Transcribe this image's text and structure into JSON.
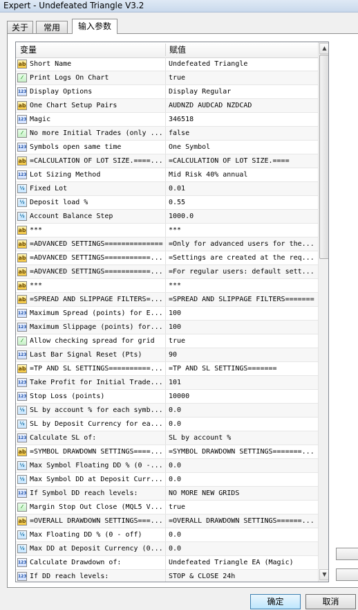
{
  "window": {
    "title": "Expert - Undefeated Triangle V3.2"
  },
  "tabs": [
    {
      "label": "关于"
    },
    {
      "label": "常用"
    },
    {
      "label": "输入参数"
    }
  ],
  "grid": {
    "columns": {
      "variable": "变量",
      "value": "赋值"
    },
    "rows": [
      {
        "icon": "string-icon",
        "name": "Short Name",
        "value": "Undefeated Triangle"
      },
      {
        "icon": "bool-icon",
        "name": "Print Logs On Chart",
        "value": "true"
      },
      {
        "icon": "int-icon",
        "name": "Display Options",
        "value": "Display Regular"
      },
      {
        "icon": "string-icon",
        "name": "One Chart Setup Pairs",
        "value": "AUDNZD AUDCAD NZDCAD"
      },
      {
        "icon": "int-icon",
        "name": "Magic",
        "value": "346518"
      },
      {
        "icon": "bool-icon",
        "name": "No more Initial Trades (only ...",
        "value": "false"
      },
      {
        "icon": "int-icon",
        "name": "Symbols open same time",
        "value": "One Symbol"
      },
      {
        "icon": "string-icon",
        "name": "=CALCULATION OF LOT SIZE.====...",
        "value": "=CALCULATION OF LOT SIZE.===="
      },
      {
        "icon": "int-icon",
        "name": "Lot Sizing Method",
        "value": "Mid Risk 40% annual"
      },
      {
        "icon": "double-icon",
        "name": "Fixed Lot",
        "value": "0.01"
      },
      {
        "icon": "double-icon",
        "name": "Deposit load %",
        "value": "0.55"
      },
      {
        "icon": "double-icon",
        "name": "Account Balance Step",
        "value": "1000.0"
      },
      {
        "icon": "string-icon",
        "name": "***",
        "value": "***"
      },
      {
        "icon": "string-icon",
        "name": "=ADVANCED SETTINGS==============",
        "value": "=Only for advanced users for the..."
      },
      {
        "icon": "string-icon",
        "name": "=ADVANCED SETTINGS===========...",
        "value": "=Settings are created at the req..."
      },
      {
        "icon": "string-icon",
        "name": "=ADVANCED SETTINGS===========...",
        "value": "=For regular users: default sett..."
      },
      {
        "icon": "string-icon",
        "name": "***",
        "value": "***"
      },
      {
        "icon": "string-icon",
        "name": "=SPREAD AND SLIPPAGE FILTERS=...",
        "value": "=SPREAD AND SLIPPAGE FILTERS======="
      },
      {
        "icon": "int-icon",
        "name": "Maximum Spread (points) for E...",
        "value": "100"
      },
      {
        "icon": "int-icon",
        "name": "Maximum Slippage (points) for...",
        "value": "100"
      },
      {
        "icon": "bool-icon",
        "name": "Allow checking spread for grid",
        "value": "true"
      },
      {
        "icon": "int-icon",
        "name": "Last Bar Signal Reset (Pts)",
        "value": "90"
      },
      {
        "icon": "string-icon",
        "name": "=TP AND SL SETTINGS==========...",
        "value": "=TP AND SL SETTINGS======="
      },
      {
        "icon": "int-icon",
        "name": "Take Profit for Initial Trade...",
        "value": "101"
      },
      {
        "icon": "int-icon",
        "name": "Stop Loss (points)",
        "value": "10000"
      },
      {
        "icon": "double-icon",
        "name": "SL by account % for each symb...",
        "value": "0.0"
      },
      {
        "icon": "double-icon",
        "name": "SL by Deposit Currency for ea...",
        "value": "0.0"
      },
      {
        "icon": "int-icon",
        "name": "Calculate SL of:",
        "value": "SL by account %"
      },
      {
        "icon": "string-icon",
        "name": "=SYMBOL DRAWDOWN SETTINGS====...",
        "value": "=SYMBOL DRAWDOWN SETTINGS=======..."
      },
      {
        "icon": "double-icon",
        "name": "Max Symbol Floating DD % (0 -...",
        "value": "0.0"
      },
      {
        "icon": "double-icon",
        "name": "Max Symbol DD at Deposit Curr...",
        "value": "0.0"
      },
      {
        "icon": "int-icon",
        "name": "If Symbol DD reach levels:",
        "value": "NO MORE NEW GRIDS"
      },
      {
        "icon": "bool-icon",
        "name": "Margin Stop Out Close (MQL5 V...",
        "value": "true"
      },
      {
        "icon": "string-icon",
        "name": "=OVERALL DRAWDOWN SETTINGS===...",
        "value": "=OVERALL DRAWDOWN SETTINGS======..."
      },
      {
        "icon": "double-icon",
        "name": "Max Floating DD % (0 - off)",
        "value": "0.0"
      },
      {
        "icon": "double-icon",
        "name": "Max DD at Deposit Currency (0...",
        "value": "0.0"
      },
      {
        "icon": "int-icon",
        "name": "Calculate Drawdown of:",
        "value": "Undefeated Triangle EA (Magic)"
      },
      {
        "icon": "int-icon",
        "name": "If DD reach levels:",
        "value": "STOP & CLOSE 24h"
      }
    ]
  },
  "buttons": {
    "ok": "确定",
    "cancel": "取消"
  }
}
